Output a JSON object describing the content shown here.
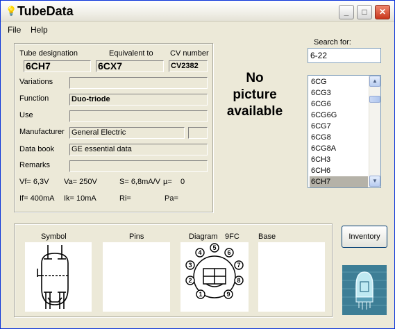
{
  "window": {
    "title": "TubeData",
    "app_icon": "lightbulb-icon",
    "minimize_glyph": "_",
    "maximize_glyph": "□",
    "close_glyph": "✕"
  },
  "menu": {
    "file": "File",
    "help": "Help"
  },
  "info": {
    "tube_designation_label": "Tube designation",
    "tube_designation": "6CH7",
    "equivalent_label": "Equivalent to",
    "equivalent": "6CX7",
    "cv_label": "CV number",
    "cv": "CV2382",
    "variations_label": "Variations",
    "variations": "",
    "function_label": "Function",
    "function": "Duo-triode",
    "use_label": "Use",
    "use": "",
    "manufacturer_label": "Manufacturer",
    "manufacturer": "General Electric",
    "manufacturer_extra": "",
    "databook_label": "Data book",
    "databook": "GE essential data",
    "remarks_label": "Remarks",
    "remarks": "",
    "params_row1": [
      "Vf= 6,3V",
      "Va= 250V",
      "S= 6,8mA/V",
      "µ=",
      "0"
    ],
    "params_row2": [
      "If= 400mA",
      "Ik= 10mA",
      "Ri=",
      "Pa="
    ]
  },
  "picture": {
    "line1": "No",
    "line2": "picture",
    "line3": "available"
  },
  "search": {
    "label": "Search for:",
    "value": "6-22"
  },
  "tube_list": {
    "items": [
      "6CG",
      "6CG3",
      "6CG6",
      "6CG6G",
      "6CG7",
      "6CG8",
      "6CG8A",
      "6CH3",
      "6CH6",
      "6CH7"
    ],
    "selected": "6CH7"
  },
  "bottom": {
    "symbol_label": "Symbol",
    "pins_label": "Pins",
    "diagram_label": "Diagram",
    "diagram_code": "9FC",
    "base_label": "Base",
    "pin_numbers": [
      "1",
      "2",
      "3",
      "4",
      "5",
      "6",
      "7",
      "8",
      "9"
    ]
  },
  "buttons": {
    "inventory": "Inventory"
  }
}
